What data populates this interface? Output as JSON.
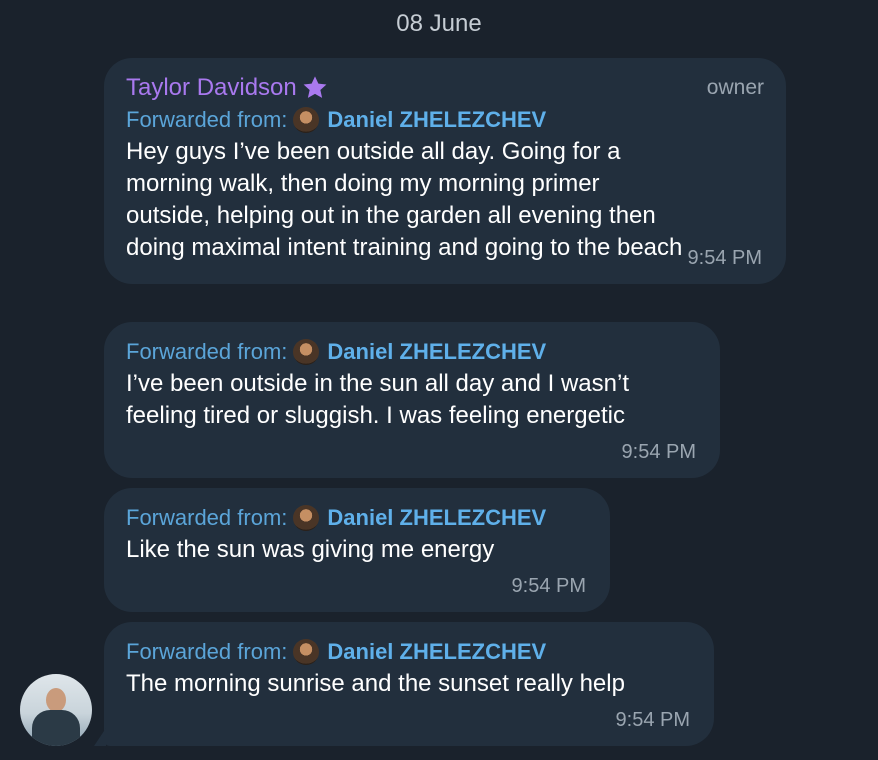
{
  "date_separator": "08 June",
  "messages": [
    {
      "sender": "Taylor Davidson",
      "role": "owner",
      "forwarded_label": "Forwarded from:",
      "forwarded_name": "Daniel ZHELEZCHEV",
      "lines": [
        "Hey guys I’ve been outside all day. Going for a",
        "morning walk, then doing my morning primer",
        "outside, helping out in the garden all evening then",
        "doing maximal intent training and going to the beach"
      ],
      "time": "9:54 PM"
    },
    {
      "forwarded_label": "Forwarded from:",
      "forwarded_name": "Daniel ZHELEZCHEV",
      "lines": [
        "I’ve been outside in the sun all day and I wasn’t",
        "feeling tired or sluggish. I was feeling energetic"
      ],
      "time": "9:54 PM"
    },
    {
      "forwarded_label": "Forwarded from:",
      "forwarded_name": "Daniel ZHELEZCHEV",
      "lines": [
        "Like the sun was giving me energy"
      ],
      "time": "9:54 PM"
    },
    {
      "forwarded_label": "Forwarded from:",
      "forwarded_name": "Daniel ZHELEZCHEV",
      "lines": [
        "The morning sunrise and the sunset really help"
      ],
      "time": "9:54 PM"
    }
  ],
  "colors": {
    "background": "#1a222c",
    "bubble": "#222f3d",
    "sender": "#a979ef",
    "forward_link": "#5fb0ea"
  },
  "icons": {
    "sender_badge": "star-icon",
    "forward_avatar": "forwarded-user-avatar"
  }
}
